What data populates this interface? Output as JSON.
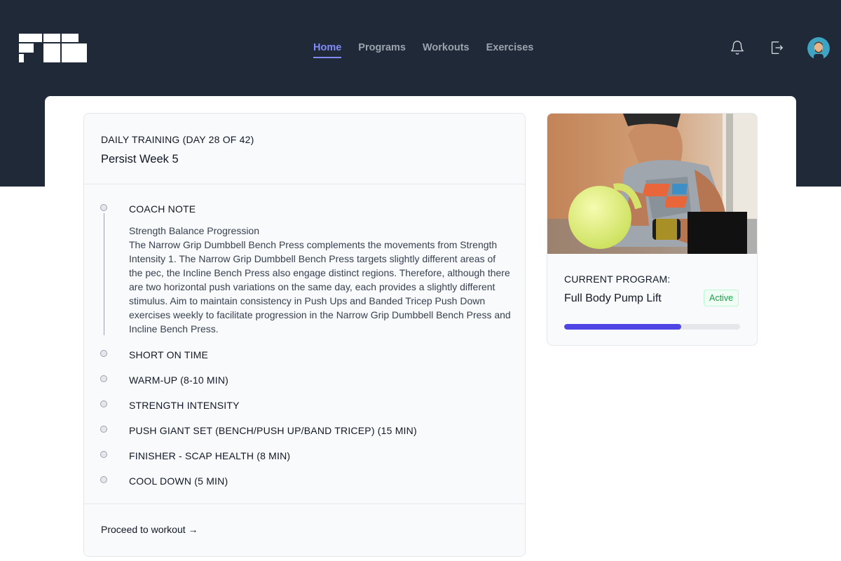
{
  "nav": {
    "items": [
      {
        "label": "Home",
        "active": true
      },
      {
        "label": "Programs",
        "active": false
      },
      {
        "label": "Workouts",
        "active": false
      },
      {
        "label": "Exercises",
        "active": false
      }
    ]
  },
  "header": {
    "icons": [
      "logo",
      "bell-icon",
      "logout-icon",
      "user-avatar"
    ]
  },
  "training": {
    "eyebrow": "DAILY TRAINING (DAY 28 OF 42)",
    "title": "Persist Week 5",
    "sections": [
      {
        "title": "COACH NOTE",
        "note_title": "Strength Balance Progression",
        "note_body": "The Narrow Grip Dumbbell Bench Press complements the movements from Strength Intensity 1. The Narrow Grip Dumbbell Bench Press targets slightly different areas of the pec, the Incline Bench Press also engage distinct regions. Therefore, although there are two horizontal push variations on the same day, each provides a slightly different stimulus. Aim to maintain consistency in Push Ups and Banded Tricep Push Down exercises weekly to facilitate progression in the Narrow Grip Dumbbell Bench Press and Incline Bench Press."
      },
      {
        "title": "SHORT ON TIME"
      },
      {
        "title": "WARM-UP (8-10 MIN)"
      },
      {
        "title": "STRENGTH INTENSITY"
      },
      {
        "title": "PUSH GIANT SET (BENCH/PUSH UP/BAND TRICEP) (15 MIN)"
      },
      {
        "title": "FINISHER - SCAP HEALTH (8 MIN)"
      },
      {
        "title": "COOL DOWN (5 MIN)"
      }
    ],
    "proceed_label": "Proceed to workout →"
  },
  "program": {
    "eyebrow": "CURRENT PROGRAM:",
    "title": "Full Body Pump Lift",
    "status": "Active",
    "progress": 0.666,
    "colors": {
      "accent": "#4f46e5",
      "status": "#16a34a"
    }
  }
}
